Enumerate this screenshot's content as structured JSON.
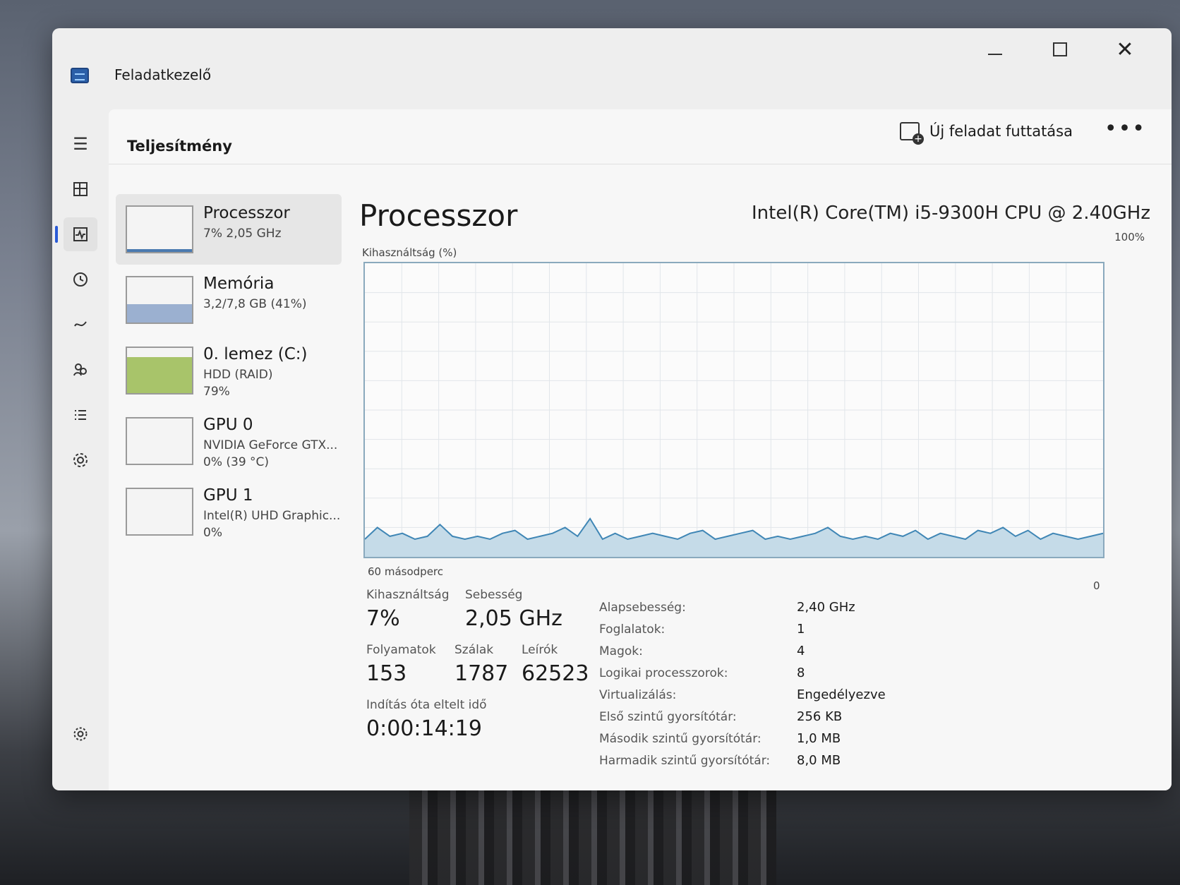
{
  "window": {
    "title": "Feladatkezelő",
    "controls": {
      "minimize": "—",
      "maximize": "",
      "close": "✕"
    }
  },
  "header": {
    "page_title": "Teljesítmény",
    "new_task_label": "Új feladat futtatása",
    "more_label": "•••"
  },
  "sidebar": {
    "items": [
      {
        "icon": "hamburger-menu-icon"
      },
      {
        "icon": "processes-icon"
      },
      {
        "icon": "performance-icon",
        "active": true
      },
      {
        "icon": "app-history-icon"
      },
      {
        "icon": "startup-apps-icon"
      },
      {
        "icon": "users-icon"
      },
      {
        "icon": "details-icon"
      },
      {
        "icon": "services-icon"
      }
    ],
    "settings_icon": "gear-icon"
  },
  "devices": [
    {
      "name": "Processzor",
      "sub": "7% 2,05 GHz",
      "sub2": "",
      "fill": 0.07,
      "color": "#4a7ab0"
    },
    {
      "name": "Memória",
      "sub": "3,2/7,8 GB (41%)",
      "sub2": "",
      "fill": 0.41,
      "color": "#9bb0d0"
    },
    {
      "name": "0. lemez (C:)",
      "sub": "HDD (RAID)",
      "sub2": "79%",
      "fill": 0.79,
      "color": "#a8c46a"
    },
    {
      "name": "GPU 0",
      "sub": "NVIDIA GeForce GTX...",
      "sub2": "0% (39 °C)",
      "fill": 0,
      "color": "#4a7ab0"
    },
    {
      "name": "GPU 1",
      "sub": "Intel(R) UHD Graphic...",
      "sub2": "0%",
      "fill": 0,
      "color": "#4a7ab0"
    }
  ],
  "main": {
    "title": "Processzor",
    "model": "Intel(R) Core(TM) i5-9300H CPU @ 2.40GHz",
    "util_axis_label": "Kihasználtság (%)",
    "max_label": "100%",
    "time_label": "60 másodperc",
    "zero_label": "0",
    "stats": {
      "util_label": "Kihasználtság",
      "util_value": "7%",
      "speed_label": "Sebesség",
      "speed_value": "2,05 GHz",
      "proc_label": "Folyamatok",
      "proc_value": "153",
      "threads_label": "Szálak",
      "threads_value": "1787",
      "handles_label": "Leírók",
      "handles_value": "62523",
      "uptime_label": "Indítás óta eltelt idő",
      "uptime_value": "0:00:14:19"
    },
    "details": [
      {
        "key": "Alapsebesség:",
        "value": "2,40 GHz"
      },
      {
        "key": "Foglalatok:",
        "value": "1"
      },
      {
        "key": "Magok:",
        "value": "4"
      },
      {
        "key": "Logikai processzorok:",
        "value": "8"
      },
      {
        "key": "Virtualizálás:",
        "value": "Engedélyezve"
      },
      {
        "key": "Első szintű gyorsítótár:",
        "value": "256 KB"
      },
      {
        "key": "Második szintű gyorsítótár:",
        "value": "1,0 MB"
      },
      {
        "key": "Harmadik szintű gyorsítótár:",
        "value": "8,0 MB"
      }
    ]
  },
  "chart_data": {
    "type": "area",
    "ylim": [
      0,
      100
    ],
    "values": [
      6,
      10,
      7,
      8,
      6,
      7,
      11,
      7,
      6,
      7,
      6,
      8,
      9,
      6,
      7,
      8,
      10,
      7,
      13,
      6,
      8,
      6,
      7,
      8,
      7,
      6,
      8,
      9,
      6,
      7,
      8,
      9,
      6,
      7,
      6,
      7,
      8,
      10,
      7,
      6,
      7,
      6,
      8,
      7,
      9,
      6,
      8,
      7,
      6,
      9,
      8,
      10,
      7,
      9,
      6,
      8,
      7,
      6,
      7,
      8
    ]
  }
}
